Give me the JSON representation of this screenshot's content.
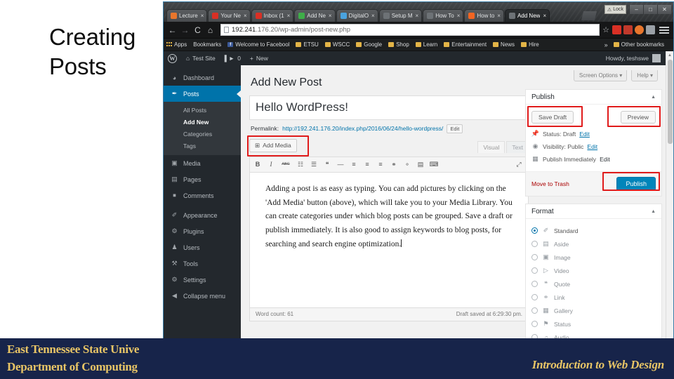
{
  "slide": {
    "title": "Creating\nPosts",
    "banner": {
      "line1": "East Tennessee State Unive",
      "line2": "Department of Computing",
      "right": "Introduction to Web Design",
      "bg_color": "#17244a",
      "text_color": "#e8c566"
    }
  },
  "browser": {
    "tabs": [
      {
        "label": "Lecture",
        "favicon_color": "#e8762c",
        "active": false
      },
      {
        "label": "Your Ne",
        "favicon_color": "#d93025",
        "active": false
      },
      {
        "label": "Inbox (1",
        "favicon_color": "#d93025",
        "active": false
      },
      {
        "label": "Add Ne",
        "favicon_color": "#3fae49",
        "active": false
      },
      {
        "label": "DigitalO",
        "favicon_color": "#4aa3df",
        "active": false
      },
      {
        "label": "Setup M",
        "favicon_color": "#6d7276",
        "active": false
      },
      {
        "label": "How To",
        "favicon_color": "#6d7276",
        "active": false
      },
      {
        "label": "How to",
        "favicon_color": "#f26522",
        "active": false
      },
      {
        "label": "Add New",
        "favicon_color": "#6d7276",
        "active": true
      }
    ],
    "tab_close_glyph": "×",
    "window_controls": {
      "minimize": "–",
      "maximize": "□",
      "close": "✕"
    },
    "warning_badge": {
      "icon": "⚠",
      "label": "Lock"
    },
    "nav": {
      "back_icon": "←",
      "forward_icon": "→",
      "reload_icon": "C",
      "home_icon": "⌂",
      "star_icon": "☆",
      "menu_icon": "menu"
    },
    "address": {
      "host": "192.241",
      "rest": ".176.20/wp-admin/post-new.php",
      "full": "192.241.176.20/wp-admin/post-new.php"
    },
    "extensions": [
      {
        "name": "gmail-extension",
        "color": "#d93025"
      },
      {
        "name": "adblock-extension",
        "color": "#c0392b"
      },
      {
        "name": "profile-extension",
        "color": "#e8762c"
      },
      {
        "name": "screenshot-extension",
        "color": "#9aa0a6"
      }
    ],
    "bookmarks": [
      {
        "label": "Apps",
        "icon": "grid"
      },
      {
        "label": "Bookmarks",
        "icon": "none"
      },
      {
        "label": "Welcome to Facebool",
        "icon": "fb"
      },
      {
        "label": "ETSU",
        "icon": "folder"
      },
      {
        "label": "WSCC",
        "icon": "folder"
      },
      {
        "label": "Google",
        "icon": "folder"
      },
      {
        "label": "Shop",
        "icon": "folder"
      },
      {
        "label": "Learn",
        "icon": "folder"
      },
      {
        "label": "Entertainment",
        "icon": "folder"
      },
      {
        "label": "News",
        "icon": "folder"
      },
      {
        "label": "Hire",
        "icon": "folder"
      }
    ],
    "bookmarks_overflow": "»",
    "other_bookmarks": "Other bookmarks"
  },
  "wp_adminbar": {
    "logo": "W",
    "site_name": "Test Site",
    "comments_count": "0",
    "new_label": "New",
    "howdy": "Howdy, teshswe"
  },
  "wp_sidebar": {
    "items": [
      {
        "label": "Dashboard",
        "icon": "⌘",
        "active": false
      },
      {
        "label": "Posts",
        "icon": "✐",
        "active": true
      },
      {
        "label": "Media",
        "icon": "▣",
        "active": false
      },
      {
        "label": "Pages",
        "icon": "☰",
        "active": false
      },
      {
        "label": "Comments",
        "icon": "⚑",
        "active": false
      },
      {
        "label": "Appearance",
        "icon": "✎",
        "active": false
      },
      {
        "label": "Plugins",
        "icon": "⚙",
        "active": false
      },
      {
        "label": "Users",
        "icon": "♟",
        "active": false
      },
      {
        "label": "Tools",
        "icon": "⚒",
        "active": false
      },
      {
        "label": "Settings",
        "icon": "⚙",
        "active": false
      },
      {
        "label": "Collapse menu",
        "icon": "◀",
        "active": false
      }
    ],
    "posts_submenu": [
      {
        "label": "All Posts",
        "current": false
      },
      {
        "label": "Add New",
        "current": true
      },
      {
        "label": "Categories",
        "current": false
      },
      {
        "label": "Tags",
        "current": false
      }
    ]
  },
  "wp_main": {
    "screen_options": "Screen Options",
    "help": "Help",
    "dropdown_caret": "▾",
    "page_title": "Add New Post",
    "post_title": "Hello WordPress!",
    "permalink_label": "Permalink:",
    "permalink_url": "http://192.241.176.20/index.php/2016/06/24/hello-wordpress/",
    "permalink_edit": "Edit",
    "add_media": "Add Media",
    "add_media_icon": "⊞",
    "editor_tabs": [
      {
        "label": "Visual",
        "active": true
      },
      {
        "label": "Text",
        "active": false
      }
    ],
    "toolbar_icons": [
      {
        "name": "bold-icon",
        "glyph": "B"
      },
      {
        "name": "italic-icon",
        "glyph": "I"
      },
      {
        "name": "strikethrough-icon",
        "glyph": "ABC"
      },
      {
        "name": "bulleted-list-icon",
        "glyph": "☷"
      },
      {
        "name": "numbered-list-icon",
        "glyph": "☰"
      },
      {
        "name": "blockquote-icon",
        "glyph": "❝"
      },
      {
        "name": "horizontal-rule-icon",
        "glyph": "—"
      },
      {
        "name": "align-left-icon",
        "glyph": "≡"
      },
      {
        "name": "align-center-icon",
        "glyph": "≡"
      },
      {
        "name": "align-right-icon",
        "glyph": "≡"
      },
      {
        "name": "insert-link-icon",
        "glyph": "⚭"
      },
      {
        "name": "unlink-icon",
        "glyph": "⚬"
      },
      {
        "name": "read-more-icon",
        "glyph": "▤"
      },
      {
        "name": "keyboard-shortcuts-icon",
        "glyph": "⌨"
      }
    ],
    "fullscreen_icon": "⤢",
    "body_text": "Adding a post is as easy as typing. You can add pictures by clicking on the 'Add Media' button (above), which will take you to your Media Library. You can create categories under which blog posts can be grouped. Save a draft or publish immediately. It is also good to assign keywords to blog posts, for searching and search engine optimization.",
    "word_count": "Word count: 61",
    "draft_saved": "Draft saved at 6:29:30 pm."
  },
  "publish_panel": {
    "title": "Publish",
    "toggle": "▲",
    "save_draft": "Save Draft",
    "preview": "Preview",
    "status_icon": "📌",
    "status_label": "Status: Draft",
    "status_edit": "Edit",
    "visibility_icon": "◉",
    "visibility_label": "Visibility: Public",
    "visibility_edit": "Edit",
    "schedule_icon": "Ὄ5",
    "schedule_label": "Publish Immediately",
    "schedule_edit": "Edit",
    "move_to_trash": "Move to Trash",
    "publish": "Publish",
    "publish_color": "#0085ba",
    "highlight_color": "#e01b1b"
  },
  "format_panel": {
    "title": "Format",
    "toggle": "▲",
    "options": [
      {
        "label": "Standard",
        "icon": "✐",
        "selected": true
      },
      {
        "label": "Aside",
        "icon": "▤",
        "selected": false
      },
      {
        "label": "Image",
        "icon": "▣",
        "selected": false
      },
      {
        "label": "Video",
        "icon": "▷",
        "selected": false
      },
      {
        "label": "Quote",
        "icon": "❝",
        "selected": false
      },
      {
        "label": "Link",
        "icon": "⚭",
        "selected": false
      },
      {
        "label": "Gallery",
        "icon": "▦",
        "selected": false
      },
      {
        "label": "Status",
        "icon": "⚑",
        "selected": false
      },
      {
        "label": "Audio",
        "icon": "♫",
        "selected": false
      }
    ]
  }
}
